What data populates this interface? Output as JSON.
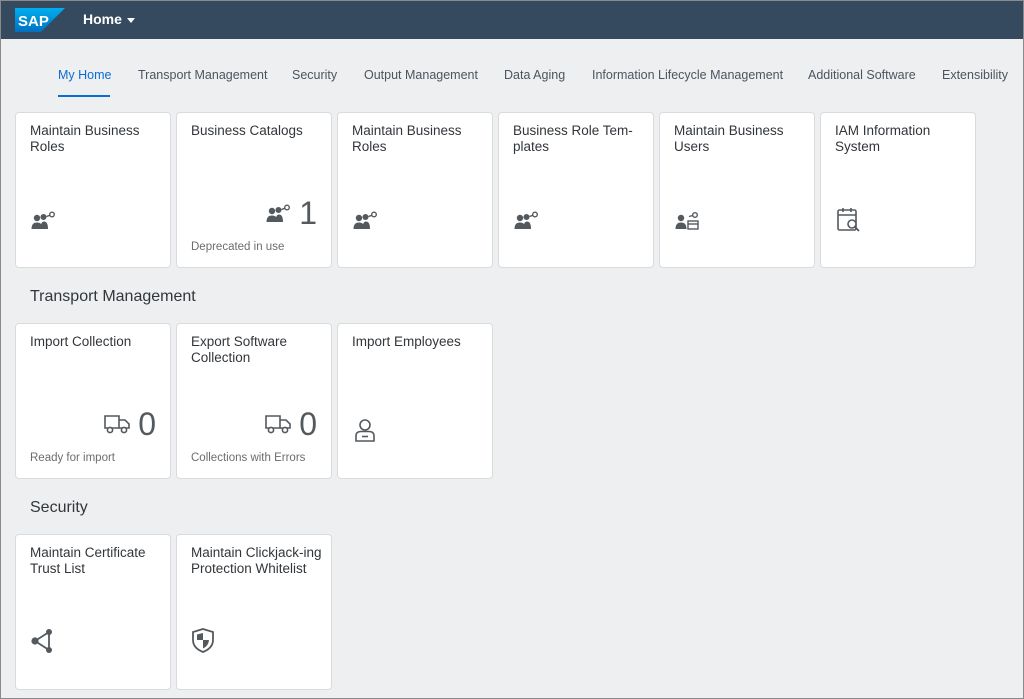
{
  "shell": {
    "logo_text": "SAP",
    "home_label": "Home"
  },
  "tabs": [
    {
      "label": "My Home"
    },
    {
      "label": "Transport Management"
    },
    {
      "label": "Security"
    },
    {
      "label": "Output Management"
    },
    {
      "label": "Data Aging"
    },
    {
      "label": "Information Lifecycle Management"
    },
    {
      "label": "Additional Software"
    },
    {
      "label": "Extensibility"
    }
  ],
  "my_home": {
    "tiles": [
      {
        "title": "Maintain Business Roles",
        "icon": "business-role-icon"
      },
      {
        "title": "Business Catalogs",
        "icon": "business-role-icon",
        "kpi": "1",
        "footer": "Deprecated in use"
      },
      {
        "title": "Maintain Business Roles",
        "icon": "business-role-icon"
      },
      {
        "title": "Business Role Tem-plates",
        "icon": "business-role-icon"
      },
      {
        "title": "Maintain Business Users",
        "icon": "business-user-icon"
      },
      {
        "title": "IAM Information System",
        "icon": "calendar-search-icon"
      }
    ]
  },
  "transport": {
    "section_title": "Transport Management",
    "tiles": [
      {
        "title": "Import Collection",
        "icon": "truck-icon",
        "kpi": "0",
        "footer": "Ready for import"
      },
      {
        "title": "Export Software Collection",
        "icon": "truck-icon",
        "kpi": "0",
        "footer": "Collections with Errors"
      },
      {
        "title": "Import Employees",
        "icon": "employee-icon"
      }
    ]
  },
  "security": {
    "section_title": "Security",
    "tiles": [
      {
        "title": "Maintain Certificate Trust List",
        "icon": "share-network-icon"
      },
      {
        "title": "Maintain Clickjack-ing Protection Whitelist",
        "icon": "shield-icon"
      }
    ]
  },
  "colors": {
    "shell": "#354a5f",
    "accent": "#0a6ed1",
    "background": "#edeff0",
    "tile": "#ffffff",
    "icon": "#54595e"
  }
}
